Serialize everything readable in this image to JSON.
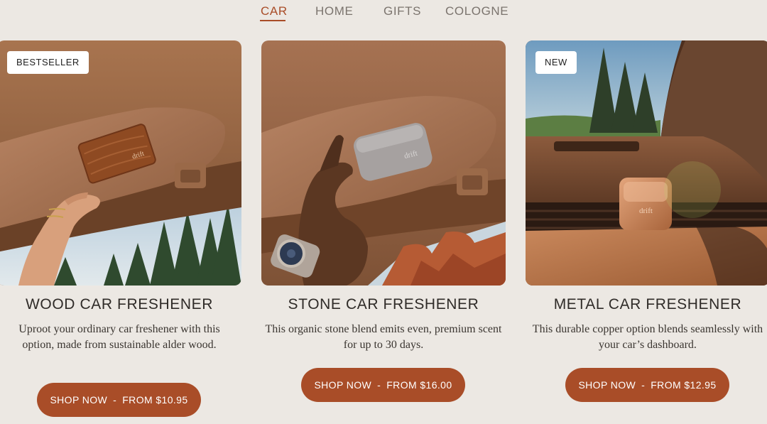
{
  "nav": {
    "tabs": [
      {
        "label": "CAR",
        "active": true
      },
      {
        "label": "HOME",
        "active": false
      },
      {
        "label": "GIFTS",
        "active": false
      },
      {
        "label": "COLOGNE",
        "active": false
      }
    ]
  },
  "products": [
    {
      "badge": "BESTSELLER",
      "title": "WOOD CAR FRESHENER",
      "description": "Uproot your ordinary car freshener with this option, made from sustainable alder wood.",
      "button_label": "SHOP NOW",
      "button_sep": "-",
      "button_price": "FROM $10.95",
      "logo_text": "drift"
    },
    {
      "badge": "",
      "title": "STONE CAR FRESHENER",
      "description": "This organic stone blend emits even, premium scent for up to 30 days.",
      "button_label": "SHOP NOW",
      "button_sep": "-",
      "button_price": "FROM $16.00",
      "logo_text": "drift"
    },
    {
      "badge": "NEW",
      "title": "METAL CAR FRESHENER",
      "description": "This durable copper option blends seamlessly with your car’s dashboard.",
      "button_label": "SHOP NOW",
      "button_sep": "-",
      "button_price": "FROM $12.95",
      "logo_text": "drift"
    }
  ],
  "colors": {
    "background": "#ECE8E3",
    "accent": "#A94D28",
    "text": "#2F2B28",
    "tab_inactive": "#7B746E"
  }
}
